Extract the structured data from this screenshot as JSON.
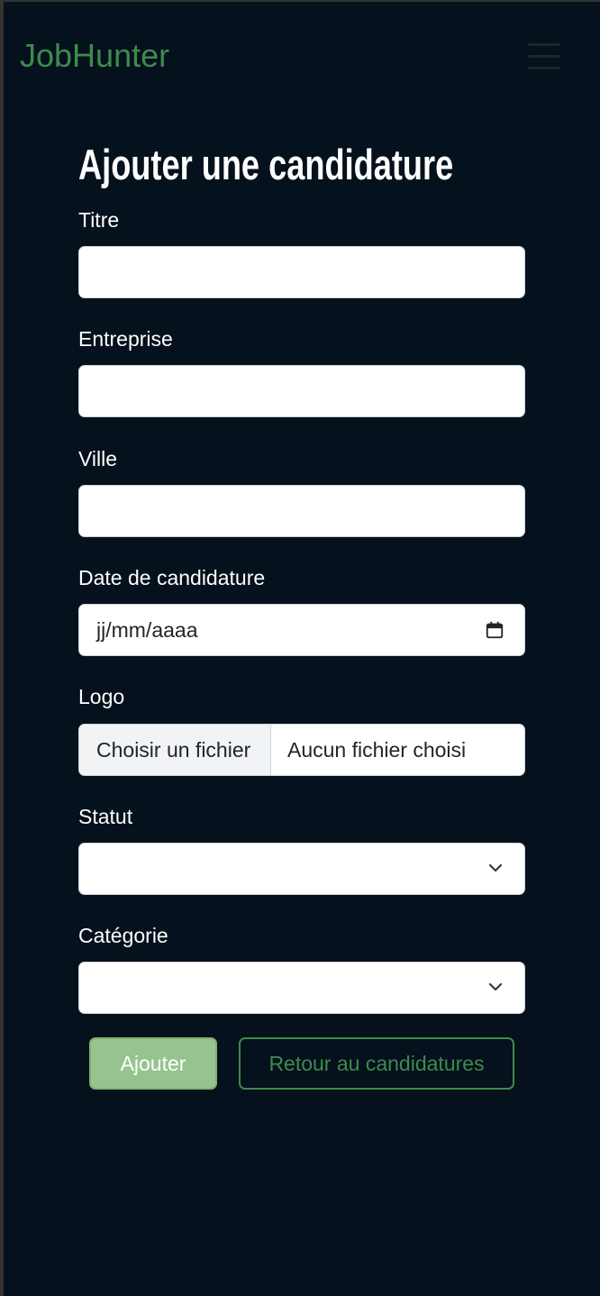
{
  "navbar": {
    "brand": "JobHunter",
    "brand_color": "#3f8a4f",
    "menu_icon": "hamburger-menu-icon"
  },
  "form": {
    "title": "Ajouter une candidature",
    "fields": {
      "titre": {
        "label": "Titre",
        "value": ""
      },
      "entreprise": {
        "label": "Entreprise",
        "value": ""
      },
      "ville": {
        "label": "Ville",
        "value": ""
      },
      "date": {
        "label": "Date de candidature",
        "placeholder": "jj/mm/aaaa",
        "icon": "calendar-icon"
      },
      "logo": {
        "label": "Logo",
        "button": "Choisir un fichier",
        "status": "Aucun fichier choisi"
      },
      "statut": {
        "label": "Statut",
        "selected": "",
        "icon": "chevron-down-icon"
      },
      "categorie": {
        "label": "Catégorie",
        "selected": "",
        "icon": "chevron-down-icon"
      }
    },
    "actions": {
      "submit": "Ajouter",
      "back": "Retour au candidatures"
    }
  },
  "colors": {
    "background": "#05111c",
    "primary_button": "#97c48e",
    "outline_accent": "#3f8a4f"
  }
}
